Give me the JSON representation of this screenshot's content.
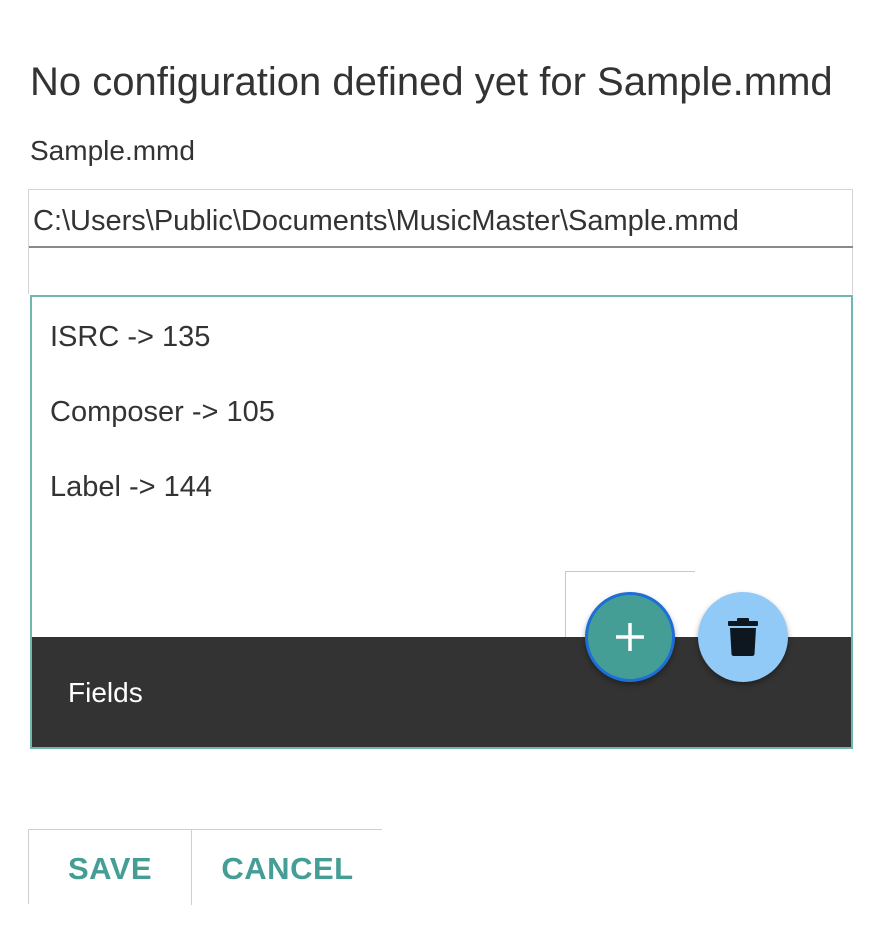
{
  "dialog": {
    "title": "No configuration defined yet for Sample.mmd",
    "filename": "Sample.mmd",
    "path_value": "C:\\Users\\Public\\Documents\\MusicMaster\\Sample.mmd"
  },
  "fields_panel": {
    "items": [
      "ISRC -> 135",
      "Composer -> 105",
      "Label -> 144"
    ],
    "footer_label": "Fields",
    "add_icon": "plus-icon",
    "delete_icon": "trash-icon"
  },
  "actions": {
    "save_label": "SAVE",
    "cancel_label": "CANCEL"
  },
  "colors": {
    "accent": "#459e96",
    "panel_border": "#6fb8b0",
    "footer_bg": "#333333",
    "delete_fab": "#91c9f7",
    "focus_ring": "#1d6ed6",
    "text": "#333333"
  }
}
